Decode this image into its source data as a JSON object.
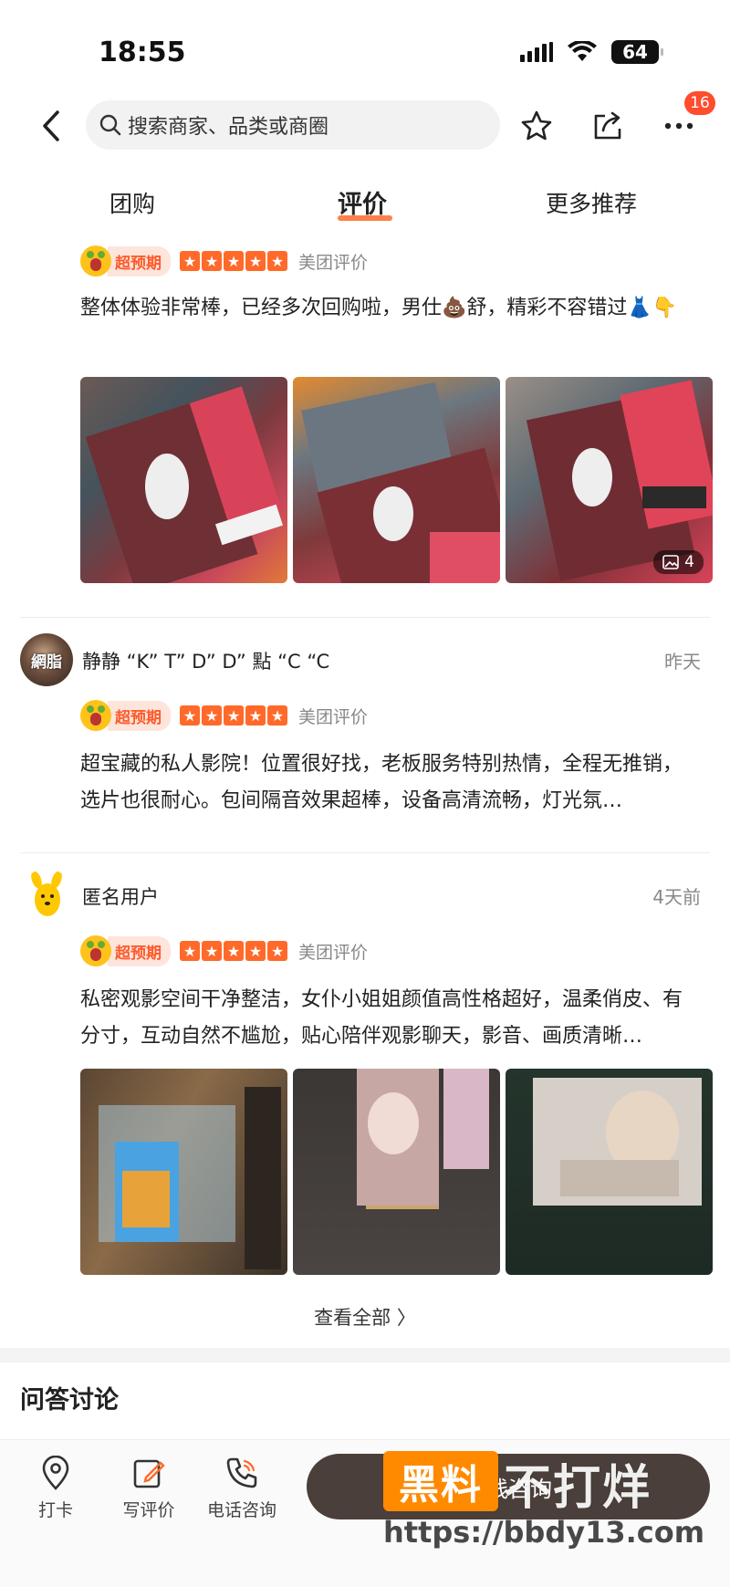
{
  "status": {
    "time": "18:55",
    "battery": "64"
  },
  "nav": {
    "search_placeholder": "搜索商家、品类或商圈",
    "notification_count": "16"
  },
  "tabs": [
    {
      "label": "团购"
    },
    {
      "label": "评价"
    },
    {
      "label": "更多推荐"
    }
  ],
  "reviews": [
    {
      "badge": "超预期",
      "source": "美团评价",
      "text": "整体体验非常棒，已经多次回购啦，男仕💩舒，精彩不容错过👗👇",
      "photo_count": "4"
    },
    {
      "username": "静静 “K” T” D” D” 點 “C “C",
      "avatar_text": "網脂",
      "time": "昨天",
      "badge": "超预期",
      "source": "美团评价",
      "text": "超宝藏的私人影院！位置很好找，老板服务特别热情，全程无推销，选片也很耐心。包间隔音效果超棒，设备高清流畅，灯光氛…"
    },
    {
      "username": "匿名用户",
      "time": "4天前",
      "badge": "超预期",
      "source": "美团评价",
      "text": "私密观影空间干净整洁，女仆小姐姐颜值高性格超好，温柔俏皮、有分寸，互动自然不尴尬，贴心陪伴观影聊天，影音、画质清晰…"
    }
  ],
  "see_all": "查看全部 〉",
  "qa_title": "问答讨论",
  "bottom_bar": {
    "checkin": "打卡",
    "write_review": "写评价",
    "phone": "电话咨询",
    "consult": "在线咨询"
  },
  "watermark": {
    "box": "黑料",
    "text": "不打烊",
    "url": "https://bbdy13.com"
  },
  "colors": {
    "accent": "#ff6a2a",
    "badge": "#ff4d2d",
    "watermark": "#ff8a00"
  }
}
